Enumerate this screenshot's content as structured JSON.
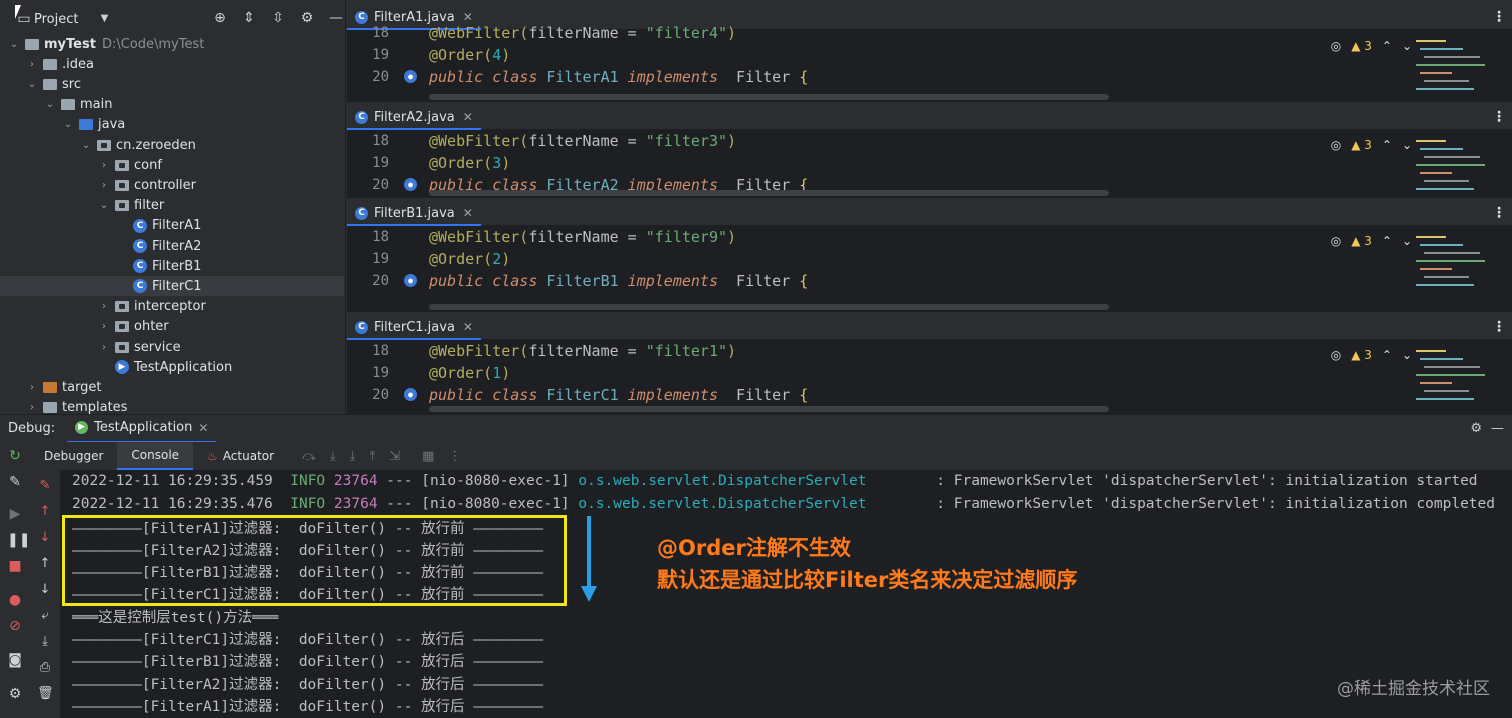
{
  "project": {
    "title": "Project",
    "tree": [
      {
        "label": "myTest",
        "path": "D:\\Code\\myTest",
        "depth": 0,
        "kind": "module",
        "expanded": true
      },
      {
        "label": ".idea",
        "depth": 1,
        "kind": "folder",
        "expanded": false
      },
      {
        "label": "src",
        "depth": 1,
        "kind": "folder",
        "expanded": true
      },
      {
        "label": "main",
        "depth": 2,
        "kind": "folder",
        "expanded": true
      },
      {
        "label": "java",
        "depth": 3,
        "kind": "folder-blue",
        "expanded": true
      },
      {
        "label": "cn.zeroeden",
        "depth": 4,
        "kind": "package",
        "expanded": true
      },
      {
        "label": "conf",
        "depth": 5,
        "kind": "package",
        "expanded": false
      },
      {
        "label": "controller",
        "depth": 5,
        "kind": "package",
        "expanded": false
      },
      {
        "label": "filter",
        "depth": 5,
        "kind": "package",
        "expanded": true
      },
      {
        "label": "FilterA1",
        "depth": 6,
        "kind": "class"
      },
      {
        "label": "FilterA2",
        "depth": 6,
        "kind": "class"
      },
      {
        "label": "FilterB1",
        "depth": 6,
        "kind": "class"
      },
      {
        "label": "FilterC1",
        "depth": 6,
        "kind": "class",
        "selected": true
      },
      {
        "label": "interceptor",
        "depth": 5,
        "kind": "package",
        "expanded": false
      },
      {
        "label": "ohter",
        "depth": 5,
        "kind": "package",
        "expanded": false
      },
      {
        "label": "service",
        "depth": 5,
        "kind": "package",
        "expanded": false
      },
      {
        "label": "TestApplication",
        "depth": 5,
        "kind": "app"
      },
      {
        "label": "target",
        "depth": 1,
        "kind": "folder-orange",
        "expanded": false
      },
      {
        "label": "templates",
        "depth": 1,
        "kind": "folder",
        "expanded": false
      }
    ]
  },
  "editors": [
    {
      "tab": "FilterA1.java",
      "lines": [
        {
          "n": "18",
          "ann": "@WebFilter(",
          "param": "filterName",
          "eq": " = ",
          "str": "\"filter4\"",
          "close": ")"
        },
        {
          "n": "19",
          "order": "@Order(",
          "num": "4",
          "close": ")"
        },
        {
          "n": "20",
          "kw1": "public class ",
          "cls": "FilterA1",
          "kw2": " implements ",
          "iface": "Filter",
          "brace": " {"
        }
      ],
      "warnings": "3"
    },
    {
      "tab": "FilterA2.java",
      "lines": [
        {
          "n": "18",
          "ann": "@WebFilter(",
          "param": "filterName",
          "eq": " = ",
          "str": "\"filter3\"",
          "close": ")"
        },
        {
          "n": "19",
          "order": "@Order(",
          "num": "3",
          "close": ")"
        },
        {
          "n": "20",
          "kw1": "public class ",
          "cls": "FilterA2",
          "kw2": " implements ",
          "iface": "Filter",
          "brace": " {"
        }
      ],
      "warnings": "3"
    },
    {
      "tab": "FilterB1.java",
      "lines": [
        {
          "n": "18",
          "ann": "@WebFilter(",
          "param": "filterName",
          "eq": " = ",
          "str": "\"filter9\"",
          "close": ")"
        },
        {
          "n": "19",
          "order": "@Order(",
          "num": "2",
          "close": ")"
        },
        {
          "n": "20",
          "kw1": "public class ",
          "cls": "FilterB1",
          "kw2": " implements ",
          "iface": "Filter",
          "brace": " {"
        }
      ],
      "warnings": "3"
    },
    {
      "tab": "FilterC1.java",
      "lines": [
        {
          "n": "18",
          "ann": "@WebFilter(",
          "param": "filterName",
          "eq": " = ",
          "str": "\"filter1\"",
          "close": ")"
        },
        {
          "n": "19",
          "order": "@Order(",
          "num": "1",
          "close": ")"
        },
        {
          "n": "20",
          "kw1": "public class ",
          "cls": "FilterC1",
          "kw2": " implements ",
          "iface": "Filter",
          "brace": " {"
        }
      ],
      "warnings": "3"
    }
  ],
  "debug": {
    "label": "Debug:",
    "run_tab": "TestApplication",
    "tabs": [
      "Debugger",
      "Console",
      "Actuator"
    ],
    "active_tab": "Console"
  },
  "console": {
    "log_lines": [
      {
        "time": "2022-12-11 16:29:35.459",
        "level": "INFO",
        "pid": "23764",
        "sep": "---",
        "thread": "[nio-8080-exec-1]",
        "logger": "o.s.web.servlet.DispatcherServlet",
        "msg": ": FrameworkServlet 'dispatcherServlet': initialization started"
      },
      {
        "time": "2022-12-11 16:29:35.476",
        "level": "INFO",
        "pid": "23764",
        "sep": "---",
        "thread": "[nio-8080-exec-1]",
        "logger": "o.s.web.servlet.DispatcherServlet",
        "msg": ": FrameworkServlet 'dispatcherServlet': initialization completed"
      }
    ],
    "output": [
      "————————[FilterA1]过滤器:  doFilter() -- 放行前 ————————",
      "————————[FilterA2]过滤器:  doFilter() -- 放行前 ————————",
      "————————[FilterB1]过滤器:  doFilter() -- 放行前 ————————",
      "————————[FilterC1]过滤器:  doFilter() -- 放行前 ————————",
      "═══这是控制层test()方法═══",
      "————————[FilterC1]过滤器:  doFilter() -- 放行后 ————————",
      "————————[FilterB1]过滤器:  doFilter() -- 放行后 ————————",
      "————————[FilterA2]过滤器:  doFilter() -- 放行后 ————————",
      "————————[FilterA1]过滤器:  doFilter() -- 放行后 ————————"
    ]
  },
  "annotation": {
    "line1": "@Order注解不生效",
    "line2": "默认还是通过比较Filter类名来决定过滤顺序"
  },
  "watermark": "@稀土掘金技术社区",
  "colors": {
    "highlight_box": "#f0e619",
    "arrow": "#29a0e3",
    "note": "#ff7a1a"
  }
}
